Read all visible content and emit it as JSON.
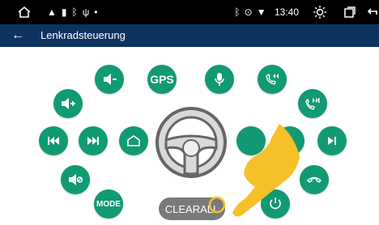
{
  "status": {
    "time": "13:40"
  },
  "header": {
    "title": "Lenkradsteuerung"
  },
  "buttons": {
    "gps": "GPS",
    "mode": "MODE",
    "clear": "CLEARALL"
  },
  "icons": {
    "home": "home-icon",
    "back": "back-arrow-icon"
  },
  "colors": {
    "accent": "#119a73",
    "titlebar": "#0d3460",
    "clear_bg": "#7a7a7a",
    "finger": "#f6c028"
  }
}
